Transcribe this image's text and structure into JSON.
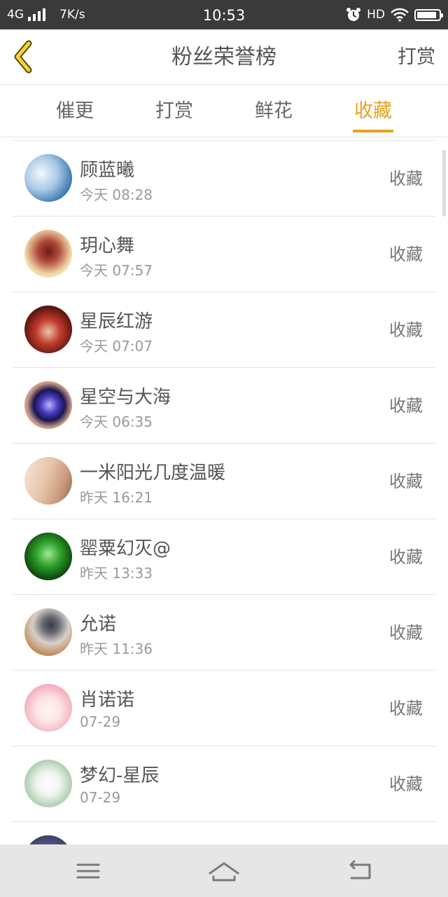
{
  "status_bar": {
    "network": "4G",
    "speed": "7K/s",
    "time": "10:53",
    "hd": "HD",
    "battery_level": 0.9
  },
  "header": {
    "title": "粉丝荣誉榜",
    "tip_label": "打赏"
  },
  "tabs": [
    {
      "label": "催更",
      "active": false
    },
    {
      "label": "打赏",
      "active": false
    },
    {
      "label": "鲜花",
      "active": false
    },
    {
      "label": "收藏",
      "active": true
    }
  ],
  "accent_color": "#e8a21c",
  "list": [
    {
      "name": "顾蓝曦",
      "time": "今天 08:28",
      "action": "收藏"
    },
    {
      "name": "玥心舞",
      "time": "今天 07:57",
      "action": "收藏"
    },
    {
      "name": "星辰红游",
      "time": "今天 07:07",
      "action": "收藏"
    },
    {
      "name": "星空与大海",
      "time": "今天 06:35",
      "action": "收藏"
    },
    {
      "name": "一米阳光几度温暖",
      "time": "昨天 16:21",
      "action": "收藏"
    },
    {
      "name": "罂粟幻灭@",
      "time": "昨天 13:33",
      "action": "收藏"
    },
    {
      "name": "允诺",
      "time": "昨天 11:36",
      "action": "收藏"
    },
    {
      "name": "肖诺诺",
      "time": "07-29",
      "action": "收藏"
    },
    {
      "name": "梦幻-星辰",
      "time": "07-29",
      "action": "收藏"
    }
  ]
}
